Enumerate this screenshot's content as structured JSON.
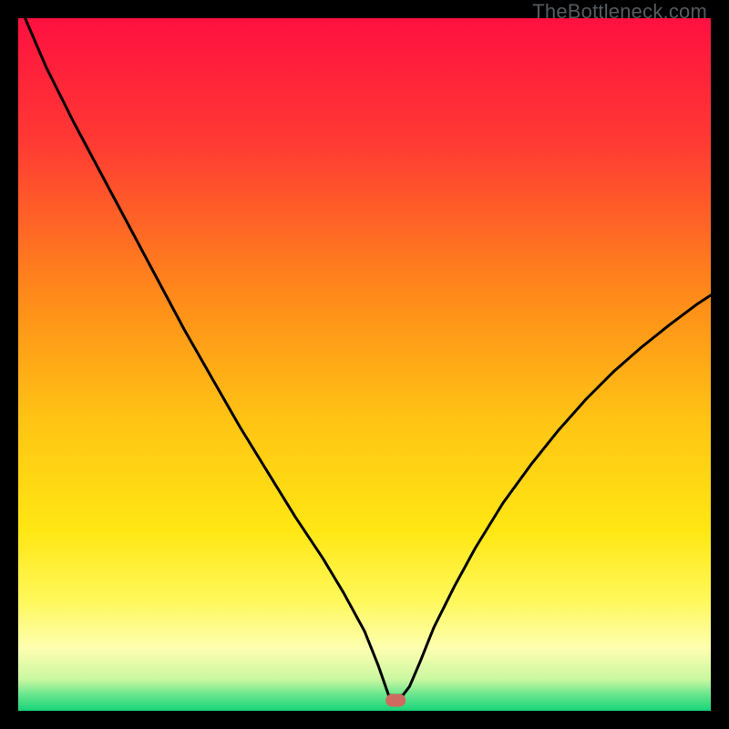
{
  "watermark": "TheBottleneck.com",
  "chart_data": {
    "type": "line",
    "title": "",
    "xlabel": "",
    "ylabel": "",
    "xlim": [
      0,
      100
    ],
    "ylim": [
      0,
      100
    ],
    "grid": false,
    "legend": false,
    "gradient_stops": [
      {
        "offset": 0.0,
        "color": "#ff1040"
      },
      {
        "offset": 0.18,
        "color": "#ff3a33"
      },
      {
        "offset": 0.4,
        "color": "#ff8a1a"
      },
      {
        "offset": 0.58,
        "color": "#ffc414"
      },
      {
        "offset": 0.74,
        "color": "#ffe714"
      },
      {
        "offset": 0.84,
        "color": "#fff85a"
      },
      {
        "offset": 0.91,
        "color": "#fdffb0"
      },
      {
        "offset": 0.955,
        "color": "#c9f7a0"
      },
      {
        "offset": 0.975,
        "color": "#6fe88f"
      },
      {
        "offset": 1.0,
        "color": "#17d57a"
      }
    ],
    "marker": {
      "x": 54.5,
      "y": 1.5,
      "color": "#cf6a60"
    },
    "series": [
      {
        "name": "bottleneck-curve",
        "x": [
          1,
          4,
          8,
          12,
          16,
          20,
          24,
          28,
          32,
          36,
          40,
          44,
          47,
          50,
          52,
          53.5,
          55.5,
          56.5,
          58,
          60,
          63,
          66,
          70,
          74,
          78,
          82,
          86,
          90,
          94,
          98,
          100
        ],
        "y": [
          100,
          93,
          85,
          77.5,
          70,
          62.5,
          55,
          48,
          41,
          34.5,
          28,
          22,
          17,
          11.5,
          6.5,
          2.2,
          2.2,
          3.5,
          7,
          12,
          18,
          23.5,
          30,
          35.5,
          40.5,
          45,
          49,
          52.5,
          55.7,
          58.7,
          60
        ]
      }
    ]
  }
}
